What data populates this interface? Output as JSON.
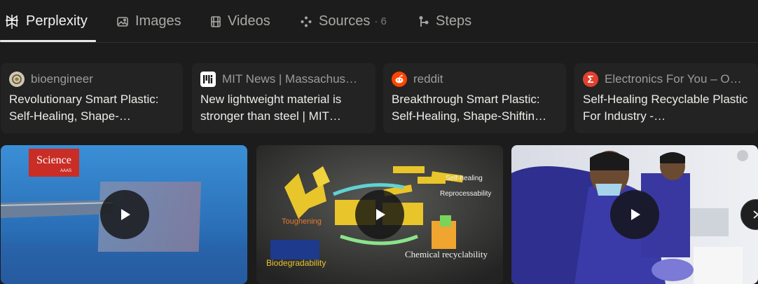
{
  "tabs": [
    {
      "label": "Perplexity",
      "icon": "perplexity-logo-icon",
      "active": true
    },
    {
      "label": "Images",
      "icon": "image-icon"
    },
    {
      "label": "Videos",
      "icon": "film-icon"
    },
    {
      "label": "Sources",
      "icon": "sources-icon",
      "count": "· 6"
    },
    {
      "label": "Steps",
      "icon": "steps-icon"
    }
  ],
  "sources": [
    {
      "source": "bioengineer",
      "title": "Revolutionary Smart Plastic: Self-Healing, Shape-…",
      "favicon": "bioengineer-favicon",
      "favicon_color": "#cfc7b4"
    },
    {
      "source": "MIT News | Massachus…",
      "title": "New lightweight material is stronger than steel | MIT…",
      "favicon": "mit-favicon",
      "favicon_color": "#ffffff"
    },
    {
      "source": "reddit",
      "title": "Breakthrough Smart Plastic: Self-Healing, Shape-Shiftin…",
      "favicon": "reddit-favicon",
      "favicon_color": "#ff4500"
    },
    {
      "source": "Electronics For You – O…",
      "title": "Self-Healing Recyclable Plastic For Industry -…",
      "favicon": "sigma-favicon",
      "favicon_color": "#e2412e"
    }
  ],
  "videos": [
    {
      "name": "video-thumbnail-science",
      "logo_text": "Science",
      "logo_sub": "AAAS"
    },
    {
      "name": "video-thumbnail-diagram",
      "labels": {
        "toughening": "Toughening",
        "self_healing": "Self-healing",
        "reprocessability": "Reprocessability",
        "chemical": "Chemical recyclability",
        "biodegradability": "Biodegradability"
      }
    },
    {
      "name": "video-thumbnail-lab"
    }
  ],
  "colors": {
    "background": "#1c1c1c",
    "card": "#232323",
    "text": "#e8e8e6",
    "muted": "#a8a8a4"
  }
}
